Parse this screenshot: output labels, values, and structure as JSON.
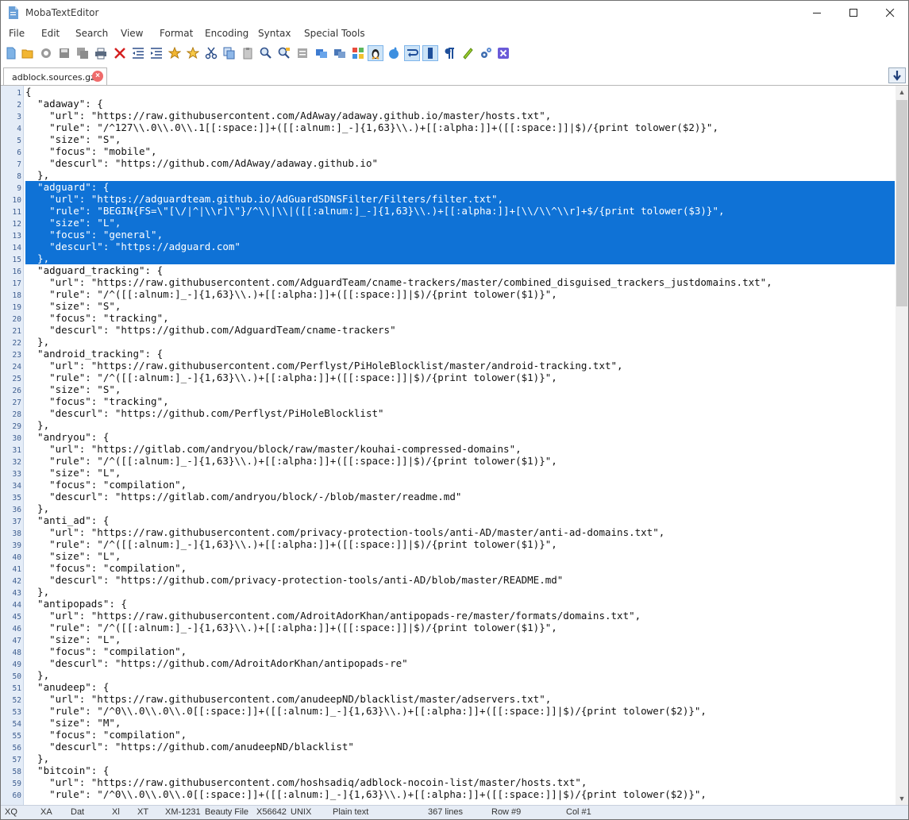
{
  "window": {
    "title": "MobaTextEditor"
  },
  "menu": [
    "File",
    "Edit",
    "Search",
    "View",
    "Format",
    "Encoding",
    "Syntax",
    "Special Tools"
  ],
  "toolbar_icons": [
    "new-file-icon",
    "open-folder-icon",
    "reload-icon",
    "save-icon",
    "save-all-icon",
    "print-icon",
    "close-file-icon",
    "indent-left-icon",
    "indent-right-icon",
    "bookmark-icon",
    "bookmark-next-icon",
    "cut-icon",
    "copy-icon",
    "paste-icon",
    "find-icon",
    "replace-icon",
    "compare-icon",
    "windows-eol-icon",
    "windows-flag-icon",
    "linux-eol-icon",
    "mac-eol-icon",
    "wrap-icon",
    "column-icon",
    "paragraph-icon",
    "highlighter-icon",
    "settings-icon",
    "close-x-icon"
  ],
  "tab": {
    "label": "adblock.sources.gz"
  },
  "code_lines": [
    "{",
    "  \"adaway\": {",
    "    \"url\": \"https://raw.githubusercontent.com/AdAway/adaway.github.io/master/hosts.txt\",",
    "    \"rule\": \"/^127\\\\.0\\\\.0\\\\.1[[:space:]]+([[:alnum:]_-]{1,63}\\\\.)+[[:alpha:]]+([[:space:]]|$)/{print tolower($2)}\",",
    "    \"size\": \"S\",",
    "    \"focus\": \"mobile\",",
    "    \"descurl\": \"https://github.com/AdAway/adaway.github.io\"",
    "  },",
    "  \"adguard\": {",
    "    \"url\": \"https://adguardteam.github.io/AdGuardSDNSFilter/Filters/filter.txt\",",
    "    \"rule\": \"BEGIN{FS=\\\"[\\/|^|\\\\r]\\\"}/^\\\\|\\\\|([[:alnum:]_-]{1,63}\\\\.)+[[:alpha:]]+[\\\\/\\\\^\\\\r]+$/{print tolower($3)}\",",
    "    \"size\": \"L\",",
    "    \"focus\": \"general\",",
    "    \"descurl\": \"https://adguard.com\"",
    "  },",
    "  \"adguard_tracking\": {",
    "    \"url\": \"https://raw.githubusercontent.com/AdguardTeam/cname-trackers/master/combined_disguised_trackers_justdomains.txt\",",
    "    \"rule\": \"/^([[:alnum:]_-]{1,63}\\\\.)+[[:alpha:]]+([[:space:]]|$)/{print tolower($1)}\",",
    "    \"size\": \"S\",",
    "    \"focus\": \"tracking\",",
    "    \"descurl\": \"https://github.com/AdguardTeam/cname-trackers\"",
    "  },",
    "  \"android_tracking\": {",
    "    \"url\": \"https://raw.githubusercontent.com/Perflyst/PiHoleBlocklist/master/android-tracking.txt\",",
    "    \"rule\": \"/^([[:alnum:]_-]{1,63}\\\\.)+[[:alpha:]]+([[:space:]]|$)/{print tolower($1)}\",",
    "    \"size\": \"S\",",
    "    \"focus\": \"tracking\",",
    "    \"descurl\": \"https://github.com/Perflyst/PiHoleBlocklist\"",
    "  },",
    "  \"andryou\": {",
    "    \"url\": \"https://gitlab.com/andryou/block/raw/master/kouhai-compressed-domains\",",
    "    \"rule\": \"/^([[:alnum:]_-]{1,63}\\\\.)+[[:alpha:]]+([[:space:]]|$)/{print tolower($1)}\",",
    "    \"size\": \"L\",",
    "    \"focus\": \"compilation\",",
    "    \"descurl\": \"https://gitlab.com/andryou/block/-/blob/master/readme.md\"",
    "  },",
    "  \"anti_ad\": {",
    "    \"url\": \"https://raw.githubusercontent.com/privacy-protection-tools/anti-AD/master/anti-ad-domains.txt\",",
    "    \"rule\": \"/^([[:alnum:]_-]{1,63}\\\\.)+[[:alpha:]]+([[:space:]]|$)/{print tolower($1)}\",",
    "    \"size\": \"L\",",
    "    \"focus\": \"compilation\",",
    "    \"descurl\": \"https://github.com/privacy-protection-tools/anti-AD/blob/master/README.md\"",
    "  },",
    "  \"antipopads\": {",
    "    \"url\": \"https://raw.githubusercontent.com/AdroitAdorKhan/antipopads-re/master/formats/domains.txt\",",
    "    \"rule\": \"/^([[:alnum:]_-]{1,63}\\\\.)+[[:alpha:]]+([[:space:]]|$)/{print tolower($1)}\",",
    "    \"size\": \"L\",",
    "    \"focus\": \"compilation\",",
    "    \"descurl\": \"https://github.com/AdroitAdorKhan/antipopads-re\"",
    "  },",
    "  \"anudeep\": {",
    "    \"url\": \"https://raw.githubusercontent.com/anudeepND/blacklist/master/adservers.txt\",",
    "    \"rule\": \"/^0\\\\.0\\\\.0\\\\.0[[:space:]]+([[:alnum:]_-]{1,63}\\\\.)+[[:alpha:]]+([[:space:]]|$)/{print tolower($2)}\",",
    "    \"size\": \"M\",",
    "    \"focus\": \"compilation\",",
    "    \"descurl\": \"https://github.com/anudeepND/blacklist\"",
    "  },",
    "  \"bitcoin\": {",
    "    \"url\": \"https://raw.githubusercontent.com/hoshsadiq/adblock-nocoin-list/master/hosts.txt\",",
    "    \"rule\": \"/^0\\\\.0\\\\.0\\\\.0[[:space:]]+([[:alnum:]_-]{1,63}\\\\.)+[[:alpha:]]+([[:space:]]|$)/{print tolower($2)}\","
  ],
  "selection": {
    "from_line": 9,
    "to_line": 15
  },
  "statusbar": [
    "XQ",
    "XA",
    "Dat",
    "Xl",
    "XT",
    "XM-1231",
    "Beauty File",
    "X56642",
    "UNIX",
    "Plain text",
    "367 lines",
    "Row #9",
    "Col #1"
  ]
}
